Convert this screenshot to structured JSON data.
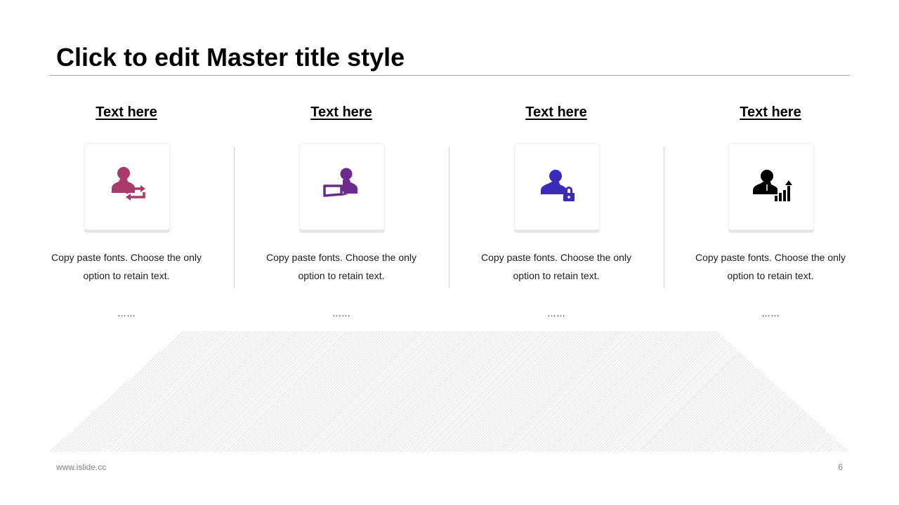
{
  "slide": {
    "title": "Click to edit Master title style",
    "footer_url": "www.islide.cc",
    "page_number": "6"
  },
  "columns": [
    {
      "heading": "Text here",
      "description": "Copy paste fonts. Choose the only option to retain text.",
      "dots": "……",
      "icon": "user-exchange-icon",
      "color": "#a93a6b"
    },
    {
      "heading": "Text here",
      "description": "Copy paste fonts. Choose the only option to retain text.",
      "dots": "……",
      "icon": "user-laptop-icon",
      "color": "#6b2a8c"
    },
    {
      "heading": "Text here",
      "description": "Copy paste fonts. Choose the only option to retain text.",
      "dots": "……",
      "icon": "user-lock-icon",
      "color": "#3a2bb8"
    },
    {
      "heading": "Text here",
      "description": "Copy paste fonts. Choose the only option to retain text.",
      "dots": "……",
      "icon": "user-growth-chart-icon",
      "color": "#000000"
    }
  ]
}
